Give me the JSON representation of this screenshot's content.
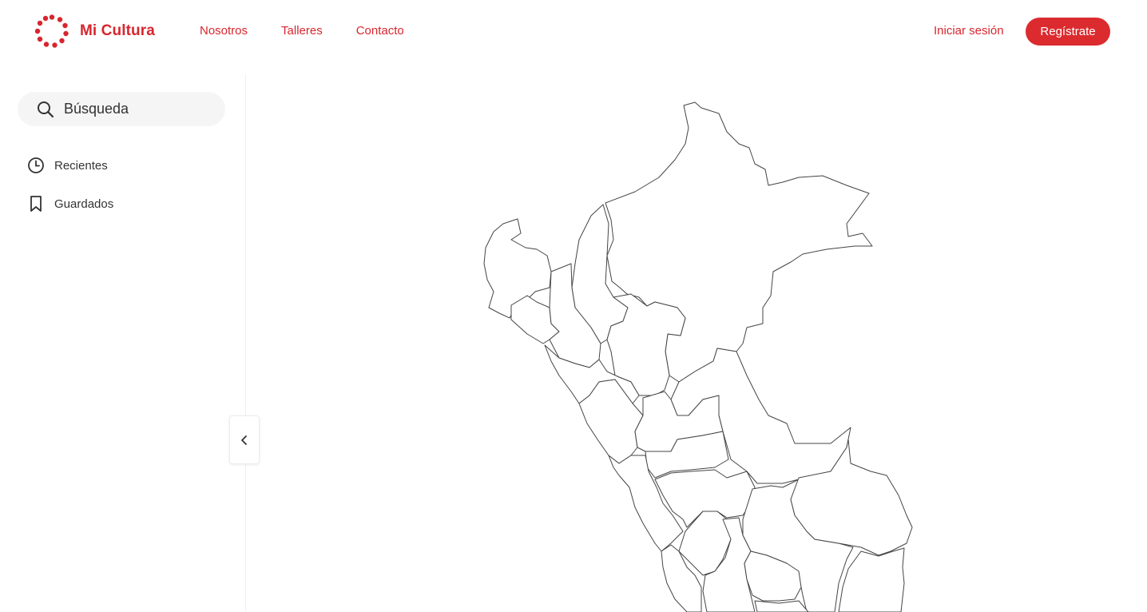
{
  "brand": {
    "name": "Mi Cultura",
    "color": "#d7262e"
  },
  "nav": {
    "items": [
      {
        "label": "Nosotros"
      },
      {
        "label": "Talleres"
      },
      {
        "label": "Contacto"
      }
    ],
    "login_label": "Iniciar sesión",
    "register_label": "Regístrate"
  },
  "sidebar": {
    "search": {
      "placeholder": "Búsqueda",
      "icon": "search-icon"
    },
    "items": [
      {
        "label": "Recientes",
        "icon": "clock-icon"
      },
      {
        "label": "Guardados",
        "icon": "bookmark-icon"
      }
    ]
  },
  "collapse": {
    "icon": "chevron-left-icon"
  },
  "map": {
    "region": "Perú",
    "stroke": "#444444"
  }
}
